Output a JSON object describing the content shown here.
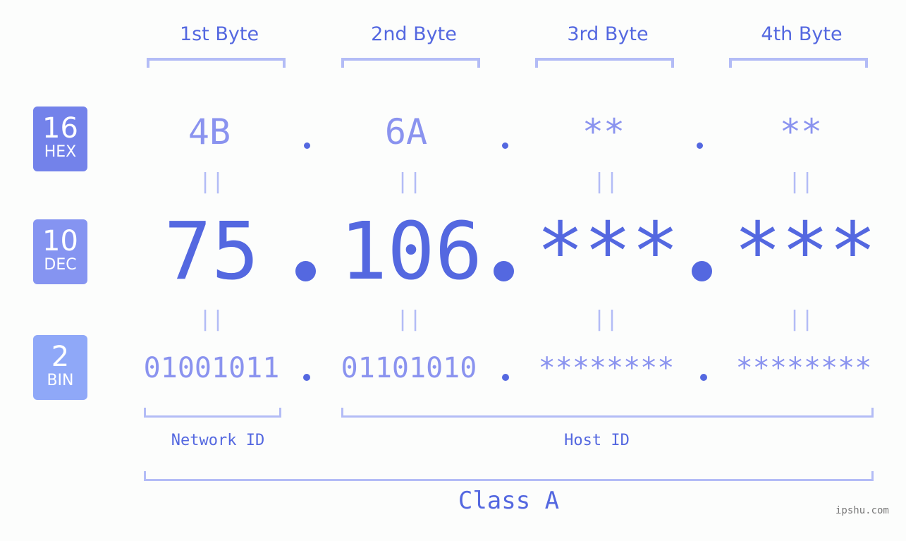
{
  "badges": [
    {
      "num": "16",
      "label": "HEX",
      "color": "#7382ea"
    },
    {
      "num": "10",
      "label": "DEC",
      "color": "#8594f1"
    },
    {
      "num": "2",
      "label": "BIN",
      "color": "#8fa8f8"
    }
  ],
  "bytes": [
    {
      "header": "1st Byte",
      "hex": "4B",
      "dec": "75",
      "bin": "01001011"
    },
    {
      "header": "2nd Byte",
      "hex": "6A",
      "dec": "106",
      "bin": "01101010"
    },
    {
      "header": "3rd Byte",
      "hex": "**",
      "dec": "***",
      "bin": "********"
    },
    {
      "header": "4th Byte",
      "hex": "**",
      "dec": "***",
      "bin": "********"
    }
  ],
  "equals_glyph": "||",
  "network_id_label": "Network ID",
  "host_id_label": "Host ID",
  "class_label": "Class A",
  "watermark": "ipshu.com",
  "colors": {
    "primary": "#5468e0",
    "light": "#8a93ef",
    "bracket": "#b3bcf6",
    "background": "#fcfdfc"
  }
}
